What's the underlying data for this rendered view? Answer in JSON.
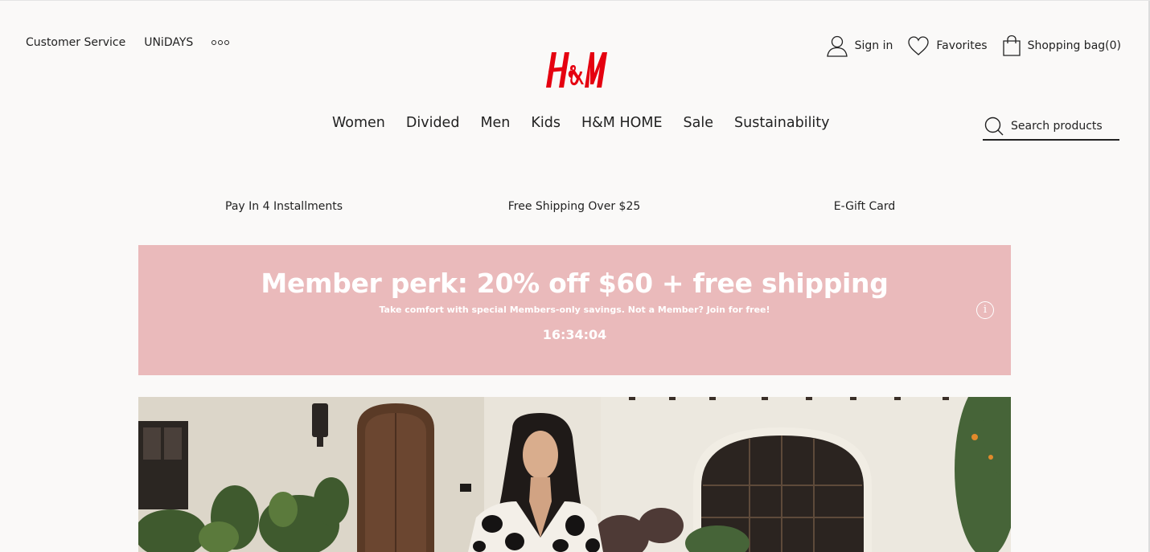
{
  "utility_links": {
    "customer_service": "Customer Service",
    "unidays": "UNiDAYS"
  },
  "account": {
    "sign_in": "Sign in",
    "favorites": "Favorites",
    "shopping_bag": "Shopping bag(0)"
  },
  "brand": {
    "logo_text": "H&M",
    "color": "#e50010"
  },
  "nav": {
    "items": [
      "Women",
      "Divided",
      "Men",
      "Kids",
      "H&M HOME",
      "Sale",
      "Sustainability"
    ]
  },
  "search": {
    "placeholder": "Search products"
  },
  "promo_strip": {
    "items": [
      "Pay In 4 Installments",
      "Free Shipping Over $25",
      "E-Gift Card"
    ]
  },
  "banner": {
    "headline": "Member perk: 20% off $60 + free shipping",
    "subtext": "Take comfort with special Members-only savings. Not a Member? Join for free!",
    "countdown": "16:34:04",
    "info_label": "i",
    "background": "#eababb"
  },
  "icons": {
    "more": "more-options-icon",
    "account": "user-icon",
    "favorites": "heart-icon",
    "bag": "shopping-bag-icon",
    "search": "search-icon",
    "info": "info-icon"
  }
}
